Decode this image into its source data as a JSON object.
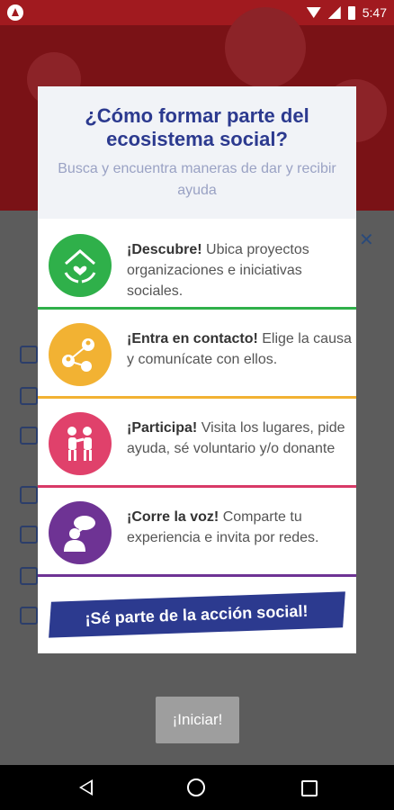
{
  "status_bar": {
    "time": "5:47"
  },
  "dialog": {
    "title": "¿Cómo formar parte del ecosistema social?",
    "subtitle": "Busca y encuentra maneras de dar y recibir ayuda",
    "items": [
      {
        "strong": "¡Descubre!",
        "text": " Ubica proyectos organizaciones e iniciativas sociales.",
        "icon": "house-heart-hands-icon",
        "color": "#2fb04a",
        "line_color": "#2fb04a"
      },
      {
        "strong": "¡Entra en contacto!",
        "text": " Elige la causa y comunícate con ellos.",
        "icon": "network-people-icon",
        "color": "#f2b233",
        "line_color": "#f2b233"
      },
      {
        "strong": "¡Participa!",
        "text": " Visita los lugares, pide ayuda, sé voluntario y/o donante",
        "icon": "people-interacting-icon",
        "color": "#e0416b",
        "line_color": "#d83a67"
      },
      {
        "strong": "¡Corre la voz!",
        "text": " Comparte tu experiencia e invita por redes.",
        "icon": "speech-bubble-person-icon",
        "color": "#6e3394",
        "line_color": "#6e3394"
      }
    ],
    "banner": "¡Sé parte de la acción social!"
  },
  "start_button": {
    "label": "¡Iniciar!"
  },
  "colors": {
    "title": "#2c3a8f",
    "status_bar": "#a11a1f"
  }
}
